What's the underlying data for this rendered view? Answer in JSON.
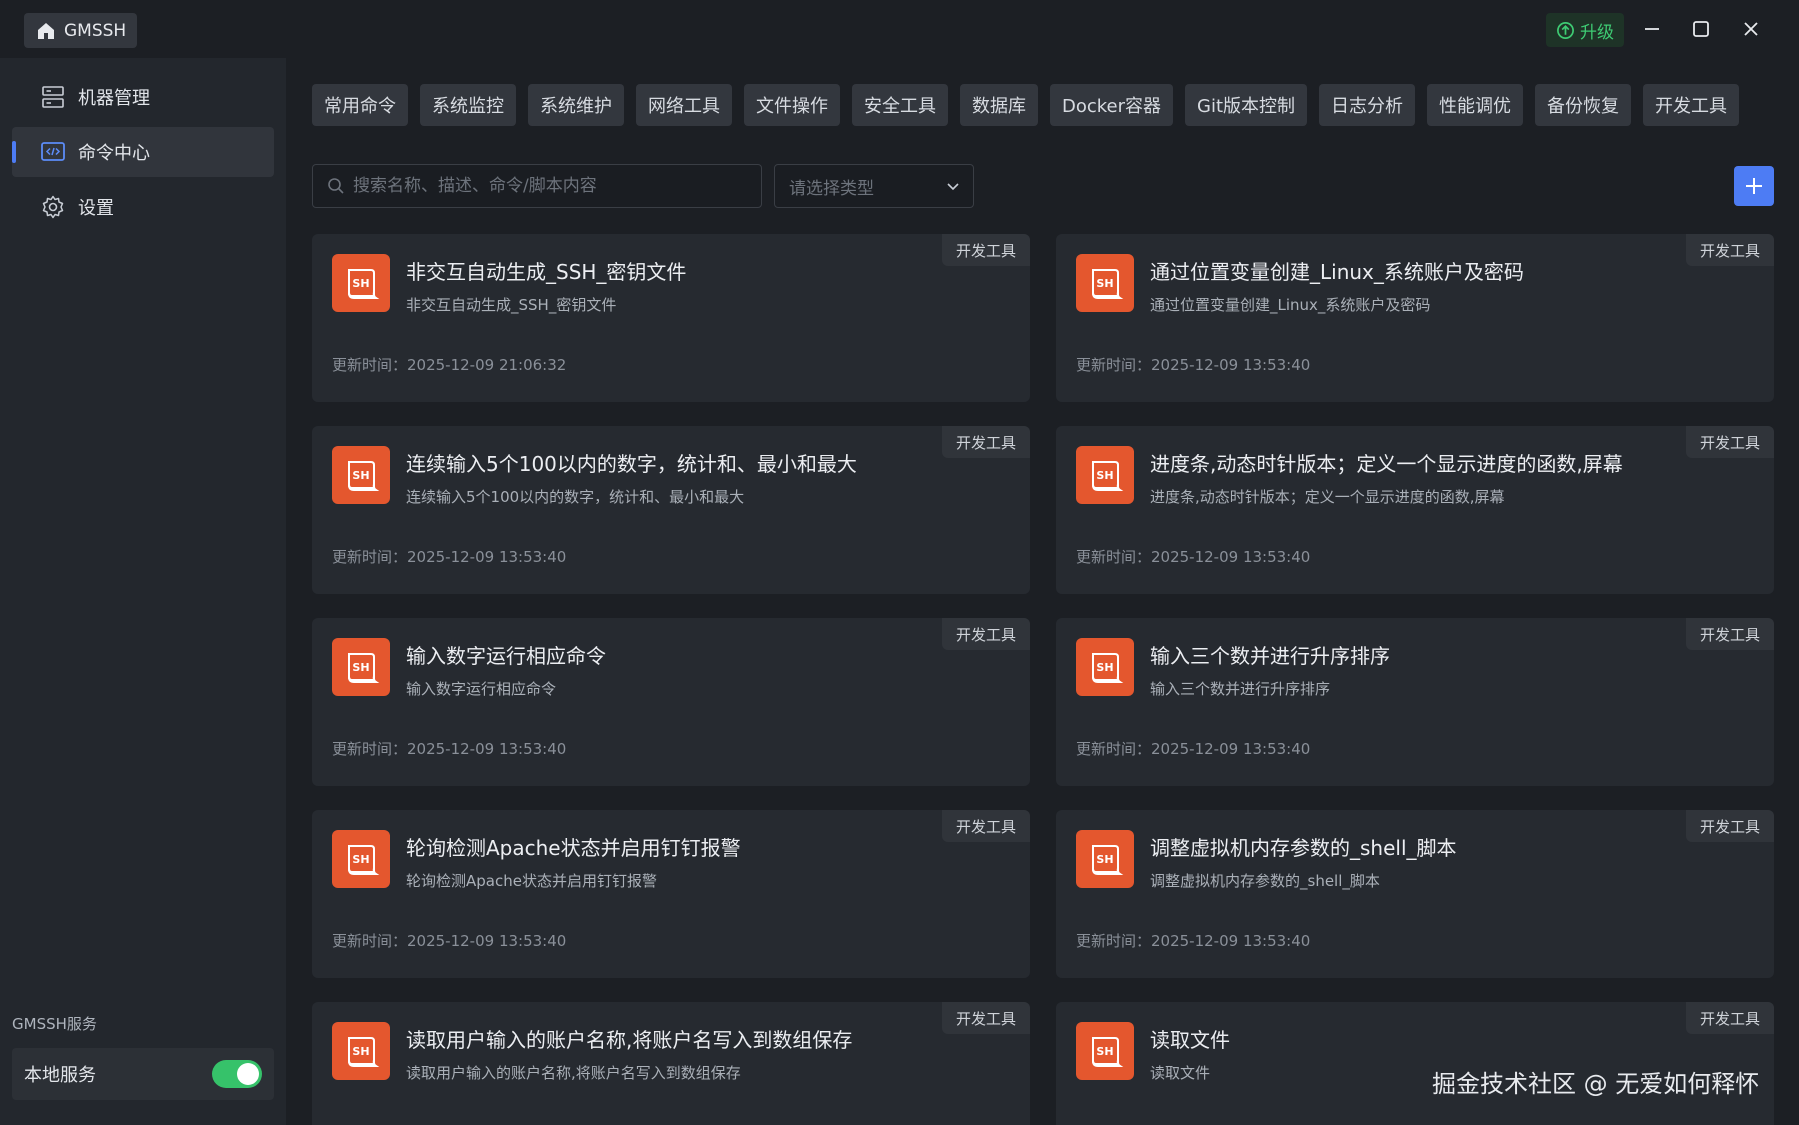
{
  "app": {
    "brand": "GMSSH",
    "upgrade_label": "升级"
  },
  "sidebar": {
    "items": [
      {
        "label": "机器管理",
        "icon": "server-icon"
      },
      {
        "label": "命令中心",
        "icon": "code-icon"
      },
      {
        "label": "设置",
        "icon": "gear-icon"
      }
    ],
    "service_title": "GMSSH服务",
    "service_label": "本地服务",
    "service_enabled": true
  },
  "tabs": [
    "常用命令",
    "系统监控",
    "系统维护",
    "网络工具",
    "文件操作",
    "安全工具",
    "数据库",
    "Docker容器",
    "Git版本控制",
    "日志分析",
    "性能调优",
    "备份恢复",
    "开发工具"
  ],
  "search": {
    "placeholder": "搜索名称、描述、命令/脚本内容",
    "type_placeholder": "请选择类型"
  },
  "time_prefix": "更新时间：",
  "cards": [
    {
      "title": "非交互自动生成_SSH_密钥文件",
      "desc": "非交互自动生成_SSH_密钥文件",
      "tag": "开发工具",
      "time": "更新时间：2025-12-09 21:06:32"
    },
    {
      "title": "通过位置变量创建_Linux_系统账户及密码",
      "desc": "通过位置变量创建_Linux_系统账户及密码",
      "tag": "开发工具",
      "time": "更新时间：2025-12-09 13:53:40"
    },
    {
      "title": "连续输入5个100以内的数字，统计和、最小和最大",
      "desc": "连续输入5个100以内的数字，统计和、最小和最大",
      "tag": "开发工具",
      "time": "更新时间：2025-12-09 13:53:40"
    },
    {
      "title": "进度条,动态时针版本；定义一个显示进度的函数,屏幕",
      "desc": "进度条,动态时针版本；定义一个显示进度的函数,屏幕",
      "tag": "开发工具",
      "time": "更新时间：2025-12-09 13:53:40"
    },
    {
      "title": "输入数字运行相应命令",
      "desc": "输入数字运行相应命令",
      "tag": "开发工具",
      "time": "更新时间：2025-12-09 13:53:40"
    },
    {
      "title": "输入三个数并进行升序排序",
      "desc": "输入三个数并进行升序排序",
      "tag": "开发工具",
      "time": "更新时间：2025-12-09 13:53:40"
    },
    {
      "title": "轮询检测Apache状态并启用钉钉报警",
      "desc": "轮询检测Apache状态并启用钉钉报警",
      "tag": "开发工具",
      "time": "更新时间：2025-12-09 13:53:40"
    },
    {
      "title": "调整虚拟机内存参数的_shell_脚本",
      "desc": "调整虚拟机内存参数的_shell_脚本",
      "tag": "开发工具",
      "time": "更新时间：2025-12-09 13:53:40"
    },
    {
      "title": "读取用户输入的账户名称,将账户名写入到数组保存",
      "desc": "读取用户输入的账户名称,将账户名写入到数组保存",
      "tag": "开发工具",
      "time": ""
    },
    {
      "title": "读取文件",
      "desc": "读取文件",
      "tag": "开发工具",
      "time": ""
    }
  ],
  "card_icon_label": "SH",
  "watermark": "掘金技术社区 @ 无爱如何释怀",
  "colors": {
    "accent": "#4d7cf4",
    "upgrade": "#3ecb73",
    "sh_icon": "#e4572e",
    "toggle_on": "#36c26a"
  }
}
